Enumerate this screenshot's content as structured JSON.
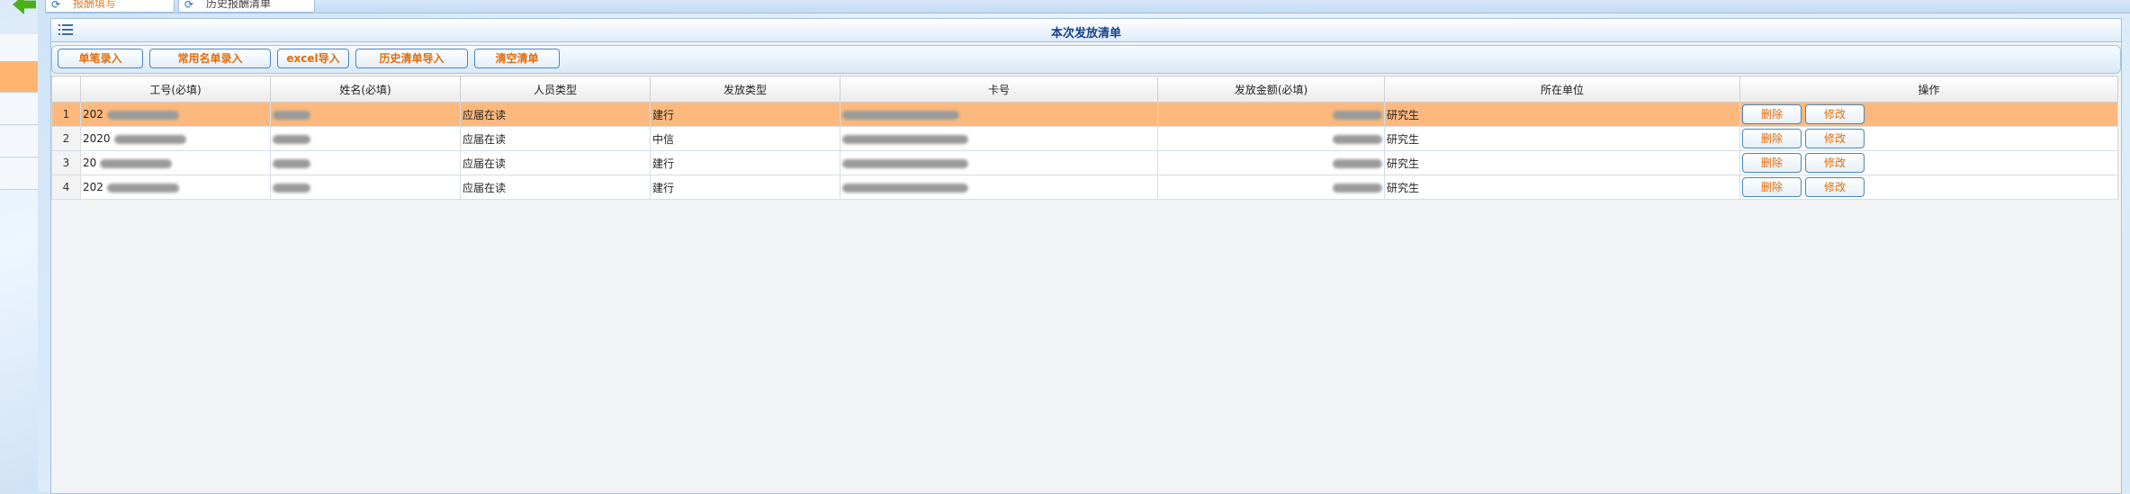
{
  "tabs": [
    {
      "label": "报酬填写"
    },
    {
      "label": "历史报酬清单"
    }
  ],
  "panel": {
    "title": "本次发放清单"
  },
  "toolbar": {
    "single_entry": "单笔录入",
    "common_entry": "常用名单录入",
    "excel_import": "excel导入",
    "history_import": "历史清单导入",
    "clear": "清空清单"
  },
  "table": {
    "columns": [
      "",
      "工号(必填)",
      "姓名(必填)",
      "人员类型",
      "发放类型",
      "卡号",
      "发放金额(必填)",
      "所在单位",
      "操作"
    ],
    "rows": [
      {
        "idx": "1",
        "id": "202",
        "person_type": "应届在读",
        "pay_type": "建行",
        "unit": "研究生"
      },
      {
        "idx": "2",
        "id": "2020",
        "person_type": "应届在读",
        "pay_type": "中信",
        "unit": "研究生"
      },
      {
        "idx": "3",
        "id": "20",
        "person_type": "应届在读",
        "pay_type": "建行",
        "unit": "研究生"
      },
      {
        "idx": "4",
        "id": "202",
        "person_type": "应届在读",
        "pay_type": "建行",
        "unit": "研究生"
      }
    ],
    "delete_label": "删除",
    "edit_label": "修改"
  },
  "colors": {
    "accent": "#e36c09",
    "selected_row": "#fdb97d",
    "title": "#15428b"
  }
}
